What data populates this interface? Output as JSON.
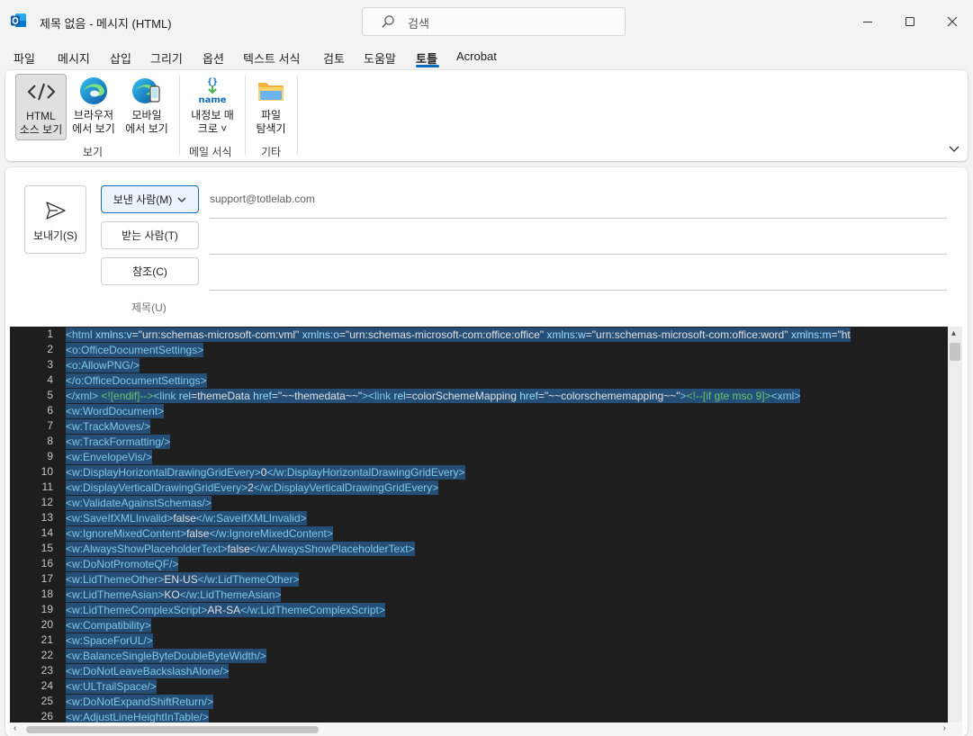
{
  "window": {
    "title": "제목 없음  -  메시지 (HTML)",
    "search_placeholder": "검색"
  },
  "menu": {
    "items": [
      "파일",
      "메시지",
      "삽입",
      "그리기",
      "옵션",
      "텍스트 서식",
      "검토",
      "도움말",
      "토틀",
      "Acrobat"
    ],
    "active": "토틀"
  },
  "ribbon": {
    "html_source": [
      "HTML",
      "소스 보기"
    ],
    "browser_view": [
      "브라우저",
      "에서 보기"
    ],
    "mobile_view": [
      "모바일",
      "에서 보기"
    ],
    "info_macro": [
      "내정보 매",
      "크로 ˅"
    ],
    "file_explorer": [
      "파일",
      "탐색기"
    ],
    "macro_icon_text": "name",
    "macro_icon_braces": "{}",
    "groups": {
      "view": "보기",
      "mail_format": "메일 서식",
      "other": "기타"
    }
  },
  "compose": {
    "send_label": "보내기(S)",
    "from_label": "보낸 사람(M)",
    "to_label": "받는 사람(T)",
    "cc_label": "참조(C)",
    "subject_label": "제목(U)",
    "from_address": "support@totlelab.com"
  },
  "colors": {
    "accent": "#0f6cbd",
    "editor_bg": "#1e1e1e",
    "selection": "#264f78"
  },
  "editor": {
    "lines": [
      [
        [
          "tag",
          "<html "
        ],
        [
          "attr",
          "xmlns:v"
        ],
        [
          "txt",
          "=\"urn:schemas-microsoft-com:vml\" "
        ],
        [
          "attr",
          "xmlns:o"
        ],
        [
          "txt",
          "=\"urn:schemas-microsoft-com:office:office\" "
        ],
        [
          "attr",
          "xmlns:w"
        ],
        [
          "txt",
          "=\"urn:schemas-microsoft-com:office:word\" "
        ],
        [
          "attr",
          "xmlns:m"
        ],
        [
          "txt",
          "=\"ht"
        ]
      ],
      [
        [
          "tag",
          "<o:OfficeDocumentSettings>"
        ]
      ],
      [
        [
          "tag",
          "<o:AllowPNG/>"
        ]
      ],
      [
        [
          "tag",
          "</o:OfficeDocumentSettings>"
        ]
      ],
      [
        [
          "tag",
          "</xml>"
        ],
        [
          "txt",
          " "
        ],
        [
          "cmt",
          "<![endif]-->"
        ],
        [
          "tag",
          "<link "
        ],
        [
          "attr",
          "rel"
        ],
        [
          "txt",
          "=themeData "
        ],
        [
          "attr",
          "href"
        ],
        [
          "txt",
          "=\"~~themedata~~\""
        ],
        [
          "tag",
          "><link "
        ],
        [
          "attr",
          "rel"
        ],
        [
          "txt",
          "=colorSchemeMapping "
        ],
        [
          "attr",
          "href"
        ],
        [
          "txt",
          "=\"~~colorschememapping~~\""
        ],
        [
          "tag",
          ">"
        ],
        [
          "cmt",
          "<!--[if gte mso 9]>"
        ],
        [
          "tag",
          "<xml>"
        ]
      ],
      [
        [
          "tag",
          "<w:WordDocument>"
        ]
      ],
      [
        [
          "tag",
          "<w:TrackMoves/>"
        ]
      ],
      [
        [
          "tag",
          "<w:TrackFormatting/>"
        ]
      ],
      [
        [
          "tag",
          "<w:EnvelopeVis/>"
        ]
      ],
      [
        [
          "tag",
          "<w:DisplayHorizontalDrawingGridEvery>"
        ],
        [
          "txt",
          "0"
        ],
        [
          "tag",
          "</w:DisplayHorizontalDrawingGridEvery>"
        ]
      ],
      [
        [
          "tag",
          "<w:DisplayVerticalDrawingGridEvery>"
        ],
        [
          "txt",
          "2"
        ],
        [
          "tag",
          "</w:DisplayVerticalDrawingGridEvery>"
        ]
      ],
      [
        [
          "tag",
          "<w:ValidateAgainstSchemas/>"
        ]
      ],
      [
        [
          "tag",
          "<w:SaveIfXMLInvalid>"
        ],
        [
          "txt",
          "false"
        ],
        [
          "tag",
          "</w:SaveIfXMLInvalid>"
        ]
      ],
      [
        [
          "tag",
          "<w:IgnoreMixedContent>"
        ],
        [
          "txt",
          "false"
        ],
        [
          "tag",
          "</w:IgnoreMixedContent>"
        ]
      ],
      [
        [
          "tag",
          "<w:AlwaysShowPlaceholderText>"
        ],
        [
          "txt",
          "false"
        ],
        [
          "tag",
          "</w:AlwaysShowPlaceholderText>"
        ]
      ],
      [
        [
          "tag",
          "<w:DoNotPromoteQF/>"
        ]
      ],
      [
        [
          "tag",
          "<w:LidThemeOther>"
        ],
        [
          "txt",
          "EN-US"
        ],
        [
          "tag",
          "</w:LidThemeOther>"
        ]
      ],
      [
        [
          "tag",
          "<w:LidThemeAsian>"
        ],
        [
          "txt",
          "KO"
        ],
        [
          "tag",
          "</w:LidThemeAsian>"
        ]
      ],
      [
        [
          "tag",
          "<w:LidThemeComplexScript>"
        ],
        [
          "txt",
          "AR-SA"
        ],
        [
          "tag",
          "</w:LidThemeComplexScript>"
        ]
      ],
      [
        [
          "tag",
          "<w:Compatibility>"
        ]
      ],
      [
        [
          "tag",
          "<w:SpaceForUL/>"
        ]
      ],
      [
        [
          "tag",
          "<w:BalanceSingleByteDoubleByteWidth/>"
        ]
      ],
      [
        [
          "tag",
          "<w:DoNotLeaveBackslashAlone/>"
        ]
      ],
      [
        [
          "tag",
          "<w:ULTrailSpace/>"
        ]
      ],
      [
        [
          "tag",
          "<w:DoNotExpandShiftReturn/>"
        ]
      ],
      [
        [
          "tag",
          "<w:AdjustLineHeightInTable/>"
        ]
      ]
    ]
  }
}
